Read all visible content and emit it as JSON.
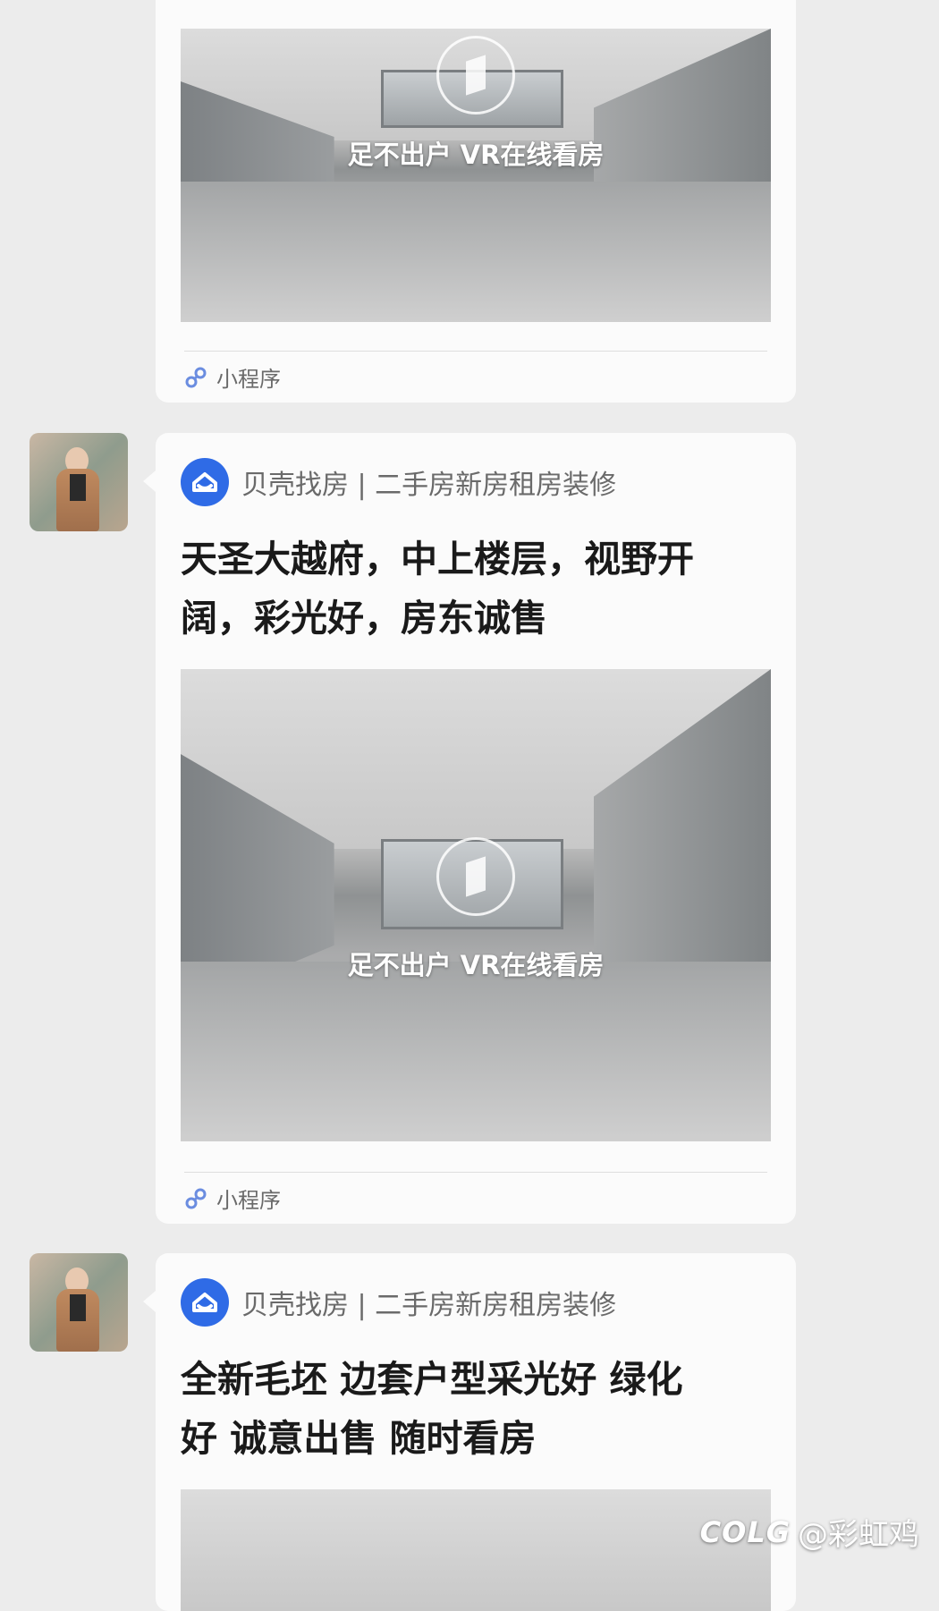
{
  "messages": [
    {
      "brand": "",
      "title_lines": [],
      "vr_text": "足不出户 VR在线看房",
      "mini_label": "小程序"
    },
    {
      "brand": "贝壳找房 | 二手房新房租房装修",
      "title_lines": [
        "天圣大越府，中上楼层，视野开",
        "阔，彩光好，房东诚售"
      ],
      "vr_text": "足不出户 VR在线看房",
      "mini_label": "小程序"
    },
    {
      "brand": "贝壳找房 | 二手房新房租房装修",
      "title_lines": [
        "全新毛坯 边套户型采光好 绿化",
        "好 诚意出售 随时看房"
      ],
      "vr_text": "",
      "mini_label": ""
    }
  ],
  "watermark": {
    "logo": "COLG",
    "user": "@彩虹鸡"
  },
  "colors": {
    "background": "#ececec",
    "card": "#fbfbfb",
    "brand_blue": "#2f6be6",
    "link_icon": "#6b8de0"
  },
  "icons": [
    "mini-program-link-icon",
    "beike-logo-icon",
    "vr-cube-icon"
  ]
}
